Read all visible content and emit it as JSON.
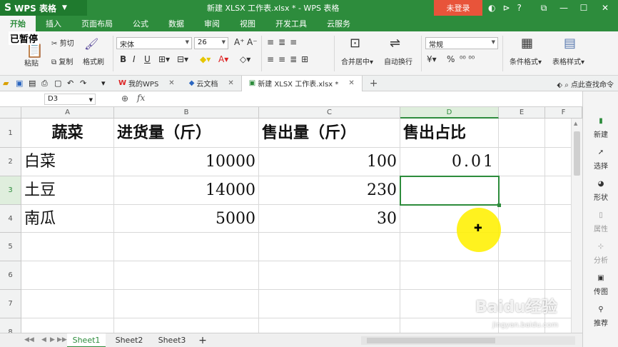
{
  "app": {
    "name": "WPS 表格",
    "doc_title": "新建 XLSX 工作表.xlsx * - WPS 表格",
    "login_label": "未登录"
  },
  "ribbon_tabs": [
    "开始",
    "插入",
    "页面布局",
    "公式",
    "数据",
    "审阅",
    "视图",
    "开发工具",
    "云服务"
  ],
  "ribbon": {
    "cut": "剪切",
    "paste": "粘贴",
    "copy": "复制",
    "format_painter": "格式刷",
    "font_name": "宋体",
    "font_size": "26",
    "bold": "B",
    "italic": "I",
    "underline": "U",
    "merge_center": "合并居中",
    "auto_wrap": "自动换行",
    "number_format": "常规",
    "percent": "%",
    "conditional_format": "条件格式",
    "table_style": "表格样式"
  },
  "doc_tabs": {
    "my_wps": "我的WPS",
    "cloud_docs": "云文档",
    "active_file": "新建 XLSX 工作表.xlsx *",
    "search_cmd": "点此查找命令"
  },
  "formula_bar": {
    "cell_ref": "D3",
    "fx": "fx",
    "content": ""
  },
  "grid": {
    "columns": [
      "A",
      "B",
      "C",
      "D",
      "E",
      "F"
    ],
    "rows": [
      "1",
      "2",
      "3",
      "4",
      "5",
      "6",
      "7",
      "8"
    ],
    "header_row": [
      "蔬菜",
      "进货量（斤）",
      "售出量（斤）",
      "售出占比"
    ],
    "data": [
      [
        "白菜",
        "10000",
        "100",
        "0.01"
      ],
      [
        "土豆",
        "14000",
        "230",
        ""
      ],
      [
        "南瓜",
        "5000",
        "30",
        ""
      ]
    ]
  },
  "side_panel": [
    "新建",
    "选择",
    "形状",
    "属性",
    "分析",
    "传图",
    "推荐"
  ],
  "sheets": [
    "Sheet1",
    "Sheet2",
    "Sheet3"
  ],
  "overlays": {
    "paused": "已暂停",
    "watermark": "Baidu经验",
    "watermark_sub": "jingyan.baidu.com"
  },
  "colors": {
    "brand_green": "#2d8c3c",
    "login_red": "#e8543a",
    "cursor_yellow": "#fff000"
  }
}
